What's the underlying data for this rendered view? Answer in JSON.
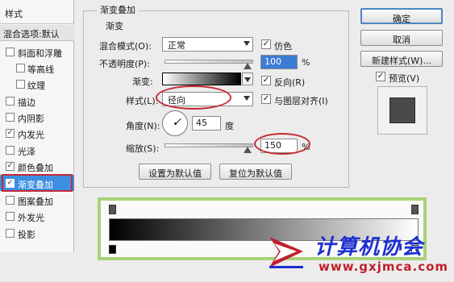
{
  "sidebar": {
    "title": "样式",
    "blend_options": "混合选项:默认",
    "items": [
      {
        "label": "斜面和浮雕",
        "checked": false
      },
      {
        "label": "等高线",
        "checked": false
      },
      {
        "label": "纹理",
        "checked": false
      },
      {
        "label": "描边",
        "checked": false
      },
      {
        "label": "内阴影",
        "checked": false
      },
      {
        "label": "内发光",
        "checked": true
      },
      {
        "label": "光泽",
        "checked": false
      },
      {
        "label": "颜色叠加",
        "checked": true
      },
      {
        "label": "渐变叠加",
        "checked": true
      },
      {
        "label": "图案叠加",
        "checked": false
      },
      {
        "label": "外发光",
        "checked": false
      },
      {
        "label": "投影",
        "checked": false
      }
    ]
  },
  "panel": {
    "group_title": "渐变叠加",
    "sub_title": "渐变",
    "blend_mode_label": "混合模式(O):",
    "blend_mode_value": "正常",
    "dither_label": "仿色",
    "opacity_label": "不透明度(P):",
    "opacity_value": "100",
    "percent": "%",
    "gradient_label": "渐变:",
    "reverse_label": "反向(R)",
    "style_label": "样式(L):",
    "style_value": "径向",
    "align_label": "与图层对齐(I)",
    "angle_label": "角度(N):",
    "angle_value": "45",
    "angle_unit": "度",
    "scale_label": "缩放(S):",
    "scale_value": "150",
    "set_default_button": "设置为默认值",
    "reset_default_button": "复位为默认值"
  },
  "actions": {
    "ok": "确定",
    "cancel": "取消",
    "new_style": "新建样式(W)...",
    "preview_label": "预览(V)"
  },
  "watermark": {
    "title": "计算机协会",
    "url": "www.gxjmca.com"
  },
  "colors": {
    "selected_bg": "#3d8ee1",
    "highlight_red": "#c42b33",
    "editor_border": "#a8d27a",
    "watermark_blue": "#1e2fd1",
    "watermark_red": "#c01f2c"
  },
  "opacity_percent": 100,
  "scale_percent": 150
}
